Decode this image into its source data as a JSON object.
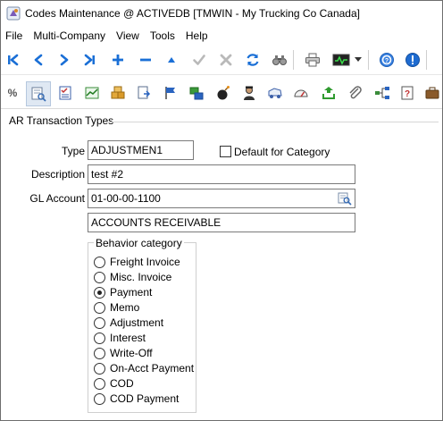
{
  "window": {
    "title": "Codes Maintenance @ ACTIVEDB [TMWIN - My Trucking Co Canada]"
  },
  "menu": [
    "File",
    "Multi-Company",
    "View",
    "Tools",
    "Help"
  ],
  "toolbar_nav": [
    {
      "name": "first-record-icon",
      "glyph": "⏮"
    },
    {
      "name": "previous-record-icon",
      "glyph": "❮"
    },
    {
      "name": "next-record-icon",
      "glyph": "❯"
    },
    {
      "name": "last-record-icon",
      "glyph": "⏭"
    },
    {
      "name": "add-record-icon",
      "glyph": "+"
    },
    {
      "name": "delete-record-icon",
      "glyph": "−"
    },
    {
      "name": "move-up-icon",
      "glyph": "▲"
    },
    {
      "name": "save-check-icon",
      "glyph": "✔"
    },
    {
      "name": "cancel-x-icon",
      "glyph": "✖"
    },
    {
      "name": "refresh-icon",
      "glyph": "⟳"
    },
    {
      "name": "find-icon",
      "glyph": "⚲"
    },
    {
      "name": "print-icon",
      "glyph": "⎙"
    },
    {
      "name": "monitor-icon",
      "glyph": "▭"
    },
    {
      "name": "dropdown-arrow-icon",
      "glyph": "▾"
    },
    {
      "name": "help-icon",
      "glyph": "?"
    },
    {
      "name": "info-icon",
      "glyph": "!"
    }
  ],
  "form": {
    "section_title": "AR Transaction Types",
    "type_label": "Type",
    "type_value": "ADJUSTMEN1",
    "default_for_category_label": "Default for Category",
    "description_label": "Description",
    "description_value": "test #2",
    "gl_account_label": "GL Account",
    "gl_account_value": "01-00-00-1100",
    "gl_account_desc": "ACCOUNTS RECEIVABLE",
    "behavior_legend": "Behavior category",
    "behavior_options": [
      {
        "label": "Freight Invoice",
        "checked": false
      },
      {
        "label": "Misc. Invoice",
        "checked": false
      },
      {
        "label": "Payment",
        "checked": true
      },
      {
        "label": "Memo",
        "checked": false
      },
      {
        "label": "Adjustment",
        "checked": false
      },
      {
        "label": "Interest",
        "checked": false
      },
      {
        "label": "Write-Off",
        "checked": false
      },
      {
        "label": "On-Acct Payment",
        "checked": false
      },
      {
        "label": "COD",
        "checked": false
      },
      {
        "label": "COD Payment",
        "checked": false
      }
    ]
  },
  "colors": {
    "nav_blue": "#1a6fd6",
    "disabled_gray": "#b9b9b9",
    "field_border": "#7a7a7a"
  }
}
